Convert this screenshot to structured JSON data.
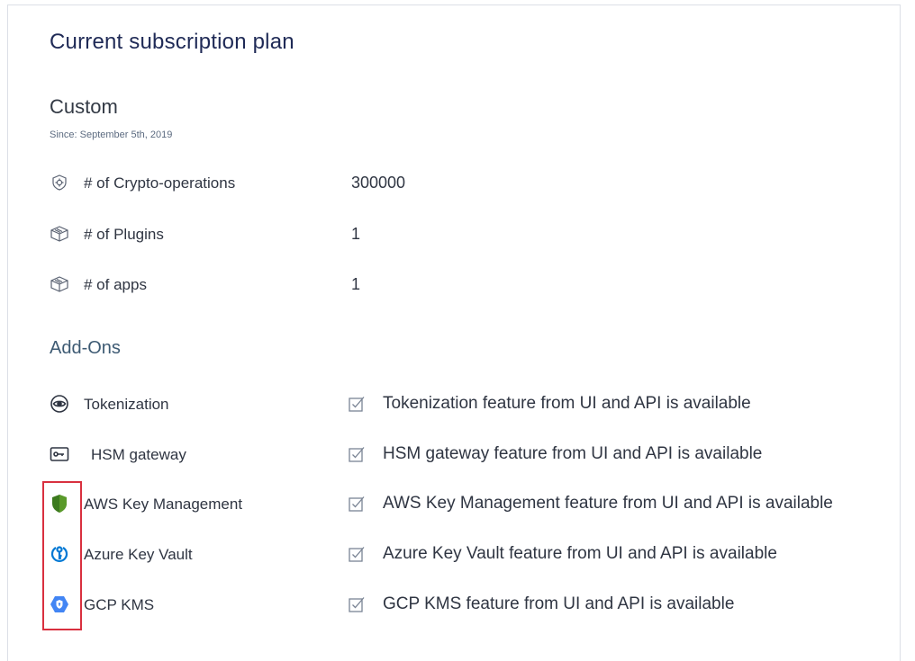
{
  "page": {
    "title": "Current subscription plan",
    "plan_name": "Custom",
    "since": "Since: September 5th, 2019"
  },
  "limits": [
    {
      "label": "# of Crypto-operations",
      "value": "300000",
      "icon": "gear-shield-icon"
    },
    {
      "label": "# of Plugins",
      "value": "1",
      "icon": "cube-icon"
    },
    {
      "label": "# of apps",
      "value": "1",
      "icon": "cube-icon"
    }
  ],
  "addons_title": "Add-Ons",
  "addons": [
    {
      "label": "Tokenization",
      "desc": "Tokenization feature from UI and API is available",
      "icon": "eye-icon"
    },
    {
      "label": "HSM gateway",
      "desc": "HSM gateway feature from UI and API is available",
      "icon": "key-card-icon"
    },
    {
      "label": "AWS Key Management",
      "desc": "AWS Key Management feature from UI and API is available",
      "icon": "aws-shield-icon"
    },
    {
      "label": "Azure Key Vault",
      "desc": "Azure Key Vault feature from UI and API is available",
      "icon": "azure-key-icon"
    },
    {
      "label": "GCP KMS",
      "desc": "GCP KMS feature from UI and API is available",
      "icon": "gcp-hexagon-icon"
    }
  ],
  "colors": {
    "title": "#1f2a56",
    "section": "#3d5a73",
    "aws": "#3c7a1e",
    "azure": "#0078d4",
    "gcp": "#4285f4",
    "highlight": "#d9303f"
  }
}
